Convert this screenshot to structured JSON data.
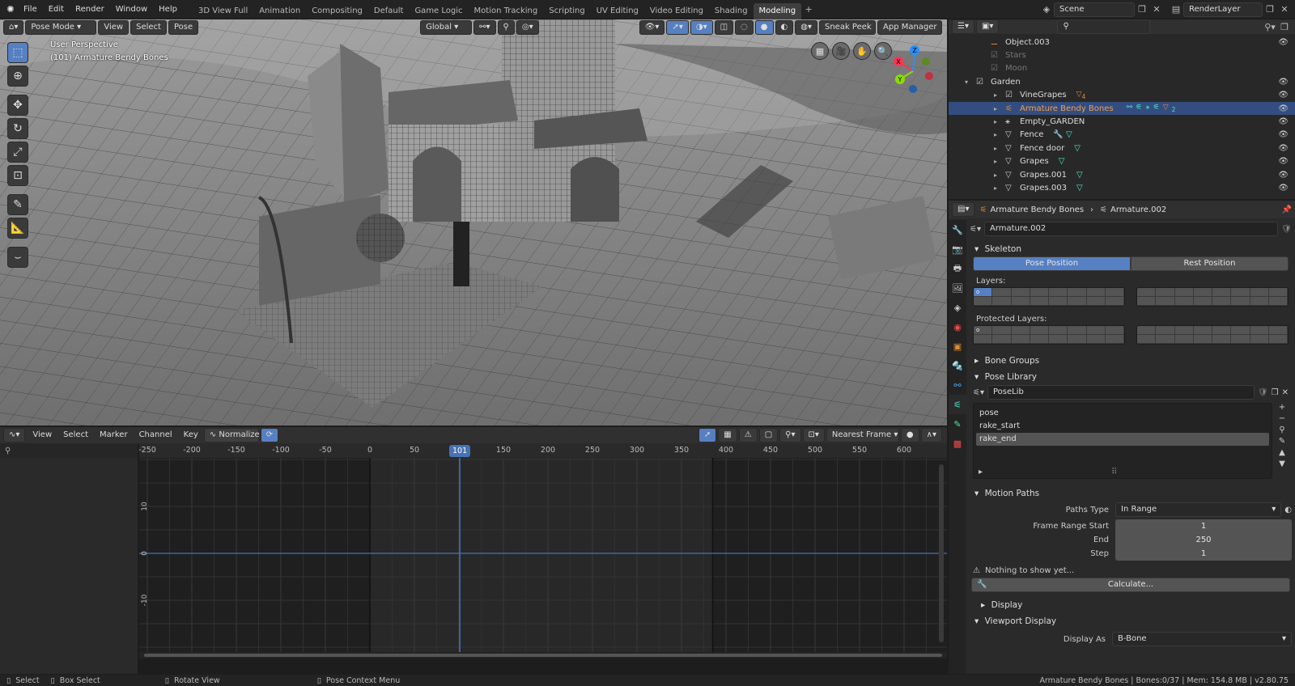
{
  "topbar": {
    "menus": [
      "File",
      "Edit",
      "Render",
      "Window",
      "Help"
    ],
    "workspaces": [
      "3D View Full",
      "Animation",
      "Compositing",
      "Default",
      "Game Logic",
      "Motion Tracking",
      "Scripting",
      "UV Editing",
      "Video Editing",
      "Shading",
      "Modeling"
    ],
    "active_workspace": "Modeling",
    "scene": "Scene",
    "render_layer": "RenderLayer"
  },
  "viewport": {
    "mode": "Pose Mode",
    "menus": [
      "View",
      "Select",
      "Pose"
    ],
    "orientation": "Global",
    "overlay_text_1": "User Perspective",
    "overlay_text_2": "(101) Armature Bendy Bones",
    "sneak_peek": "Sneak Peek",
    "app_manager": "App Manager",
    "gizmo_axes": [
      "X",
      "Y",
      "Z"
    ]
  },
  "graph": {
    "menus": [
      "View",
      "Select",
      "Marker",
      "Channel",
      "Key"
    ],
    "normalize": "Normalize",
    "snap": "Nearest Frame",
    "frame_ticks": [
      "-250",
      "-200",
      "-150",
      "-100",
      "-50",
      "0",
      "50",
      "",
      "150",
      "200",
      "250",
      "300",
      "350",
      "400",
      "450",
      "500",
      "550",
      "600"
    ],
    "current_frame": "101",
    "y_ticks": [
      "10",
      "0",
      "-10"
    ]
  },
  "outliner": {
    "rows": [
      {
        "name": "Object.003",
        "indent": 1,
        "icon": "bone",
        "color": "#e08b3a"
      },
      {
        "name": "Stars",
        "indent": 1,
        "icon": "check",
        "color": "#777",
        "dim": true
      },
      {
        "name": "Moon",
        "indent": 1,
        "icon": "check",
        "color": "#777",
        "dim": true
      },
      {
        "name": "Garden",
        "indent": 0,
        "icon": "check",
        "color": "#ccc"
      },
      {
        "name": "VineGrapes",
        "indent": 2,
        "icon": "check",
        "color": "#ccc"
      },
      {
        "name": "Armature Bendy Bones",
        "indent": 2,
        "icon": "armature",
        "color": "#e08b3a",
        "selected": true
      },
      {
        "name": "Empty_GARDEN",
        "indent": 2,
        "icon": "empty",
        "color": "#ccc"
      },
      {
        "name": "Fence",
        "indent": 2,
        "icon": "mesh",
        "color": "#ccc"
      },
      {
        "name": "Fence door",
        "indent": 2,
        "icon": "mesh",
        "color": "#ccc"
      },
      {
        "name": "Grapes",
        "indent": 2,
        "icon": "mesh",
        "color": "#ccc"
      },
      {
        "name": "Grapes.001",
        "indent": 2,
        "icon": "mesh",
        "color": "#ccc"
      },
      {
        "name": "Grapes.003",
        "indent": 2,
        "icon": "mesh",
        "color": "#ccc"
      }
    ],
    "badge_vinegrapes": "4",
    "badge_armature": "2"
  },
  "props": {
    "breadcrumb_object": "Armature Bendy Bones",
    "breadcrumb_data": "Armature.002",
    "data_name": "Armature.002",
    "skeleton": "Skeleton",
    "pose_position": "Pose Position",
    "rest_position": "Rest Position",
    "layers_label": "Layers:",
    "protected_label": "Protected Layers:",
    "bone_groups": "Bone Groups",
    "pose_library": "Pose Library",
    "poselib_name": "PoseLib",
    "poses": [
      "pose",
      "rake_start",
      "rake_end"
    ],
    "active_pose": "rake_end",
    "motion_paths": "Motion Paths",
    "paths_type_label": "Paths Type",
    "paths_type": "In Range",
    "frame_range_start_label": "Frame Range Start",
    "frame_range_start": "1",
    "end_label": "End",
    "end": "250",
    "step_label": "Step",
    "step": "1",
    "nothing_msg": "Nothing to show yet...",
    "calculate": "Calculate...",
    "display": "Display",
    "viewport_display": "Viewport Display",
    "display_as_label": "Display As",
    "display_as": "B-Bone"
  },
  "status": {
    "select": "Select",
    "box_select": "Box Select",
    "rotate_view": "Rotate View",
    "context_menu": "Pose Context Menu",
    "info": "Armature Bendy Bones | Bones:0/37 | Mem: 154.8 MB | v2.80.75"
  },
  "colors": {
    "accent": "#5680c2",
    "selected_row": "#334d80",
    "orange": "#e08b3a"
  }
}
